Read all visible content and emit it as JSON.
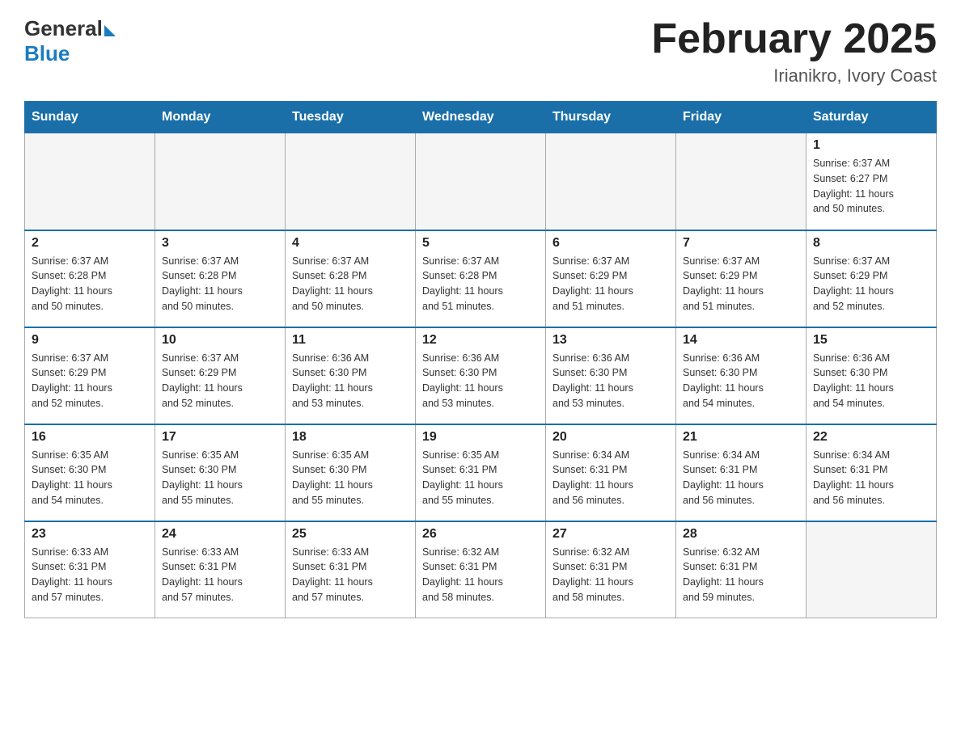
{
  "header": {
    "logo": {
      "text_general": "General",
      "text_blue": "Blue",
      "arrow_color": "#1a7dc0"
    },
    "title": "February 2025",
    "subtitle": "Irianikro, Ivory Coast"
  },
  "calendar": {
    "days_of_week": [
      "Sunday",
      "Monday",
      "Tuesday",
      "Wednesday",
      "Thursday",
      "Friday",
      "Saturday"
    ],
    "weeks": [
      {
        "days": [
          {
            "date": "",
            "info": ""
          },
          {
            "date": "",
            "info": ""
          },
          {
            "date": "",
            "info": ""
          },
          {
            "date": "",
            "info": ""
          },
          {
            "date": "",
            "info": ""
          },
          {
            "date": "",
            "info": ""
          },
          {
            "date": "1",
            "info": "Sunrise: 6:37 AM\nSunset: 6:27 PM\nDaylight: 11 hours\nand 50 minutes."
          }
        ]
      },
      {
        "days": [
          {
            "date": "2",
            "info": "Sunrise: 6:37 AM\nSunset: 6:28 PM\nDaylight: 11 hours\nand 50 minutes."
          },
          {
            "date": "3",
            "info": "Sunrise: 6:37 AM\nSunset: 6:28 PM\nDaylight: 11 hours\nand 50 minutes."
          },
          {
            "date": "4",
            "info": "Sunrise: 6:37 AM\nSunset: 6:28 PM\nDaylight: 11 hours\nand 50 minutes."
          },
          {
            "date": "5",
            "info": "Sunrise: 6:37 AM\nSunset: 6:28 PM\nDaylight: 11 hours\nand 51 minutes."
          },
          {
            "date": "6",
            "info": "Sunrise: 6:37 AM\nSunset: 6:29 PM\nDaylight: 11 hours\nand 51 minutes."
          },
          {
            "date": "7",
            "info": "Sunrise: 6:37 AM\nSunset: 6:29 PM\nDaylight: 11 hours\nand 51 minutes."
          },
          {
            "date": "8",
            "info": "Sunrise: 6:37 AM\nSunset: 6:29 PM\nDaylight: 11 hours\nand 52 minutes."
          }
        ]
      },
      {
        "days": [
          {
            "date": "9",
            "info": "Sunrise: 6:37 AM\nSunset: 6:29 PM\nDaylight: 11 hours\nand 52 minutes."
          },
          {
            "date": "10",
            "info": "Sunrise: 6:37 AM\nSunset: 6:29 PM\nDaylight: 11 hours\nand 52 minutes."
          },
          {
            "date": "11",
            "info": "Sunrise: 6:36 AM\nSunset: 6:30 PM\nDaylight: 11 hours\nand 53 minutes."
          },
          {
            "date": "12",
            "info": "Sunrise: 6:36 AM\nSunset: 6:30 PM\nDaylight: 11 hours\nand 53 minutes."
          },
          {
            "date": "13",
            "info": "Sunrise: 6:36 AM\nSunset: 6:30 PM\nDaylight: 11 hours\nand 53 minutes."
          },
          {
            "date": "14",
            "info": "Sunrise: 6:36 AM\nSunset: 6:30 PM\nDaylight: 11 hours\nand 54 minutes."
          },
          {
            "date": "15",
            "info": "Sunrise: 6:36 AM\nSunset: 6:30 PM\nDaylight: 11 hours\nand 54 minutes."
          }
        ]
      },
      {
        "days": [
          {
            "date": "16",
            "info": "Sunrise: 6:35 AM\nSunset: 6:30 PM\nDaylight: 11 hours\nand 54 minutes."
          },
          {
            "date": "17",
            "info": "Sunrise: 6:35 AM\nSunset: 6:30 PM\nDaylight: 11 hours\nand 55 minutes."
          },
          {
            "date": "18",
            "info": "Sunrise: 6:35 AM\nSunset: 6:30 PM\nDaylight: 11 hours\nand 55 minutes."
          },
          {
            "date": "19",
            "info": "Sunrise: 6:35 AM\nSunset: 6:31 PM\nDaylight: 11 hours\nand 55 minutes."
          },
          {
            "date": "20",
            "info": "Sunrise: 6:34 AM\nSunset: 6:31 PM\nDaylight: 11 hours\nand 56 minutes."
          },
          {
            "date": "21",
            "info": "Sunrise: 6:34 AM\nSunset: 6:31 PM\nDaylight: 11 hours\nand 56 minutes."
          },
          {
            "date": "22",
            "info": "Sunrise: 6:34 AM\nSunset: 6:31 PM\nDaylight: 11 hours\nand 56 minutes."
          }
        ]
      },
      {
        "days": [
          {
            "date": "23",
            "info": "Sunrise: 6:33 AM\nSunset: 6:31 PM\nDaylight: 11 hours\nand 57 minutes."
          },
          {
            "date": "24",
            "info": "Sunrise: 6:33 AM\nSunset: 6:31 PM\nDaylight: 11 hours\nand 57 minutes."
          },
          {
            "date": "25",
            "info": "Sunrise: 6:33 AM\nSunset: 6:31 PM\nDaylight: 11 hours\nand 57 minutes."
          },
          {
            "date": "26",
            "info": "Sunrise: 6:32 AM\nSunset: 6:31 PM\nDaylight: 11 hours\nand 58 minutes."
          },
          {
            "date": "27",
            "info": "Sunrise: 6:32 AM\nSunset: 6:31 PM\nDaylight: 11 hours\nand 58 minutes."
          },
          {
            "date": "28",
            "info": "Sunrise: 6:32 AM\nSunset: 6:31 PM\nDaylight: 11 hours\nand 59 minutes."
          },
          {
            "date": "",
            "info": ""
          }
        ]
      }
    ]
  }
}
